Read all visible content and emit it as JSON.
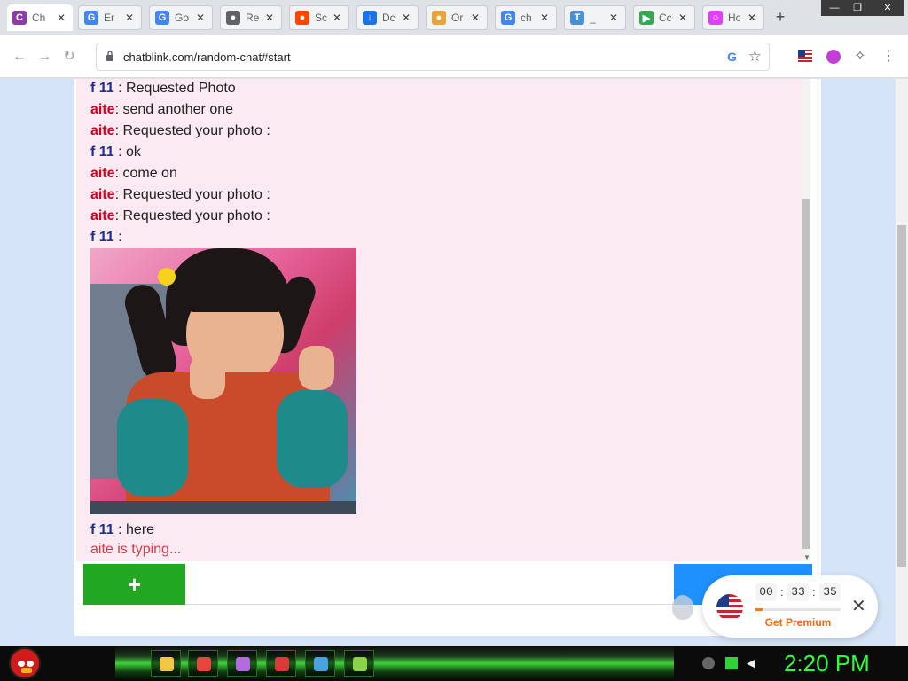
{
  "browser": {
    "tabs": [
      {
        "title": "Ch",
        "icon": "chatblink-icon",
        "color": "#8e3aa8",
        "glyph": "C"
      },
      {
        "title": "Er",
        "icon": "google-icon",
        "color": "#4285f4",
        "glyph": "G"
      },
      {
        "title": "Go",
        "icon": "google-icon",
        "color": "#4285f4",
        "glyph": "G"
      },
      {
        "title": "Re",
        "icon": "globe-icon",
        "color": "#5f6368",
        "glyph": "●"
      },
      {
        "title": "Sc",
        "icon": "reddit-icon",
        "color": "#ff4500",
        "glyph": "●"
      },
      {
        "title": "Dc",
        "icon": "download-icon",
        "color": "#1a73e8",
        "glyph": "↓"
      },
      {
        "title": "Or",
        "icon": "chrome-icon",
        "color": "#e8a33c",
        "glyph": "●"
      },
      {
        "title": "ch",
        "icon": "google-icon",
        "color": "#4285f4",
        "glyph": "G"
      },
      {
        "title": "_",
        "icon": "translate-icon",
        "color": "#4a90d9",
        "glyph": "T"
      },
      {
        "title": "Cc",
        "icon": "play-store-icon",
        "color": "#34a853",
        "glyph": "▶"
      },
      {
        "title": "Hc",
        "icon": "hangouts-icon",
        "color": "#e040fb",
        "glyph": "○"
      }
    ],
    "new_tab": "+",
    "window_controls": {
      "minimize": "—",
      "maximize": "❐",
      "close": "✕"
    },
    "url": "chatblink.com/random-chat#start",
    "nav": {
      "back": "←",
      "forward": "→",
      "reload": "↻"
    },
    "omnibox_google": "G",
    "bookmark_star": "☆",
    "menu": "⋮"
  },
  "chat": {
    "messages": [
      {
        "sender": "f 11",
        "sep": " : ",
        "text": "Requested Photo",
        "kind": "f"
      },
      {
        "sender": "aite",
        "sep": ": ",
        "text": "send another one",
        "kind": "a"
      },
      {
        "sender": "aite",
        "sep": ": ",
        "text": "Requested your photo :",
        "kind": "a"
      },
      {
        "sender": "f 11",
        "sep": " : ",
        "text": "ok",
        "kind": "f"
      },
      {
        "sender": "aite",
        "sep": ": ",
        "text": "come on",
        "kind": "a"
      },
      {
        "sender": "aite",
        "sep": ": ",
        "text": "Requested your photo :",
        "kind": "a"
      },
      {
        "sender": "aite",
        "sep": ": ",
        "text": "Requested your photo :",
        "kind": "a"
      },
      {
        "sender": "f 11",
        "sep": " :",
        "text": "",
        "kind": "f"
      },
      {
        "sender": "f 11",
        "sep": " : ",
        "text": "here",
        "kind": "f"
      }
    ],
    "typing": "aite is typing...",
    "add_button": "+",
    "input_value": "",
    "input_placeholder": ""
  },
  "timer": {
    "hours": "00",
    "minutes": "33",
    "seconds": "35",
    "sep": ":",
    "progress": 0.08,
    "premium_label": "Get Premium",
    "close": "✕",
    "flag": "us-flag-icon"
  },
  "taskbar": {
    "clock": "2:20 PM",
    "items": [
      {
        "icon": "file-explorer-icon",
        "color": "#f2c744"
      },
      {
        "icon": "chrome-icon",
        "color": "#e8453c"
      },
      {
        "icon": "tor-browser-icon",
        "color": "#b46ae0"
      },
      {
        "icon": "media-player-icon",
        "color": "#d83a3a"
      },
      {
        "icon": "screenshot-tool-icon",
        "color": "#4aa3df"
      },
      {
        "icon": "folder-sync-icon",
        "color": "#8bd14a"
      }
    ]
  }
}
